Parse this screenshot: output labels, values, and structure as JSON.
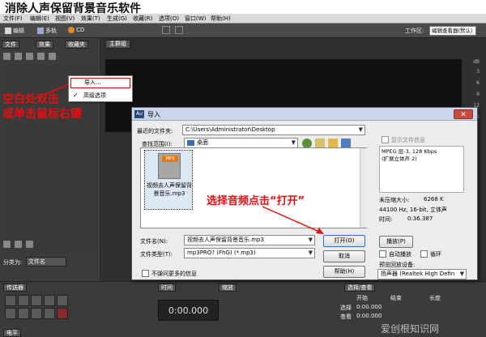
{
  "headline": "消除人声保留背景音乐软件",
  "menu": [
    "文件(F)",
    "编辑(E)",
    "视图(V)",
    "效果(T)",
    "生成(G)",
    "收藏(R)",
    "选项(O)",
    "窗口(W)",
    "帮助(H)"
  ],
  "toolbar": {
    "edit_label": "编辑",
    "multitrack_label": "多轨",
    "cd_label": "CD",
    "workspace_label": "工作区:",
    "workspace_value": "编辑查看器(默认)"
  },
  "left_panel": {
    "tabs": [
      "文件",
      "效果",
      "收藏夹"
    ],
    "sort_label": "分类为:",
    "sort_value": "文件名"
  },
  "main": {
    "tab": "主群组",
    "db_ticks": [
      "dB",
      "3",
      "6",
      "9",
      "12",
      "15"
    ]
  },
  "context_menu": {
    "items": [
      "导入...",
      "高级选项"
    ],
    "checked": "✓"
  },
  "annotations": {
    "left_line1": "空白处双击",
    "left_line2": "或单击鼠标右键",
    "middle": "选择音频点击“打开”"
  },
  "dialog": {
    "title": "导入",
    "recent_label": "最近的文件夹:",
    "recent_value": "C:\\Users\\Administrator\\Desktop",
    "lookin_label": "查找范围(I):",
    "lookin_value": "桌面",
    "file": {
      "badge": "MP3",
      "name": "视频去人声保留背景音乐.mp3"
    },
    "filename_label": "文件名(N):",
    "filename_value": "视频去人声保留背景音乐.mp3",
    "filetype_label": "文件类型(T):",
    "filetype_value": "mp3PRO? (FhG) (*.mp3)",
    "open_button": "打开(O)",
    "cancel_button": "取消",
    "help_button": "帮助(H)",
    "no_more_info": "不弹问更多的信息",
    "show_info_label": "显示文件信息",
    "info_text": "MPEG 层-3, 128 Kbps\n(扩展立体声 2)",
    "uncompressed_label": "未压缩大小:",
    "uncompressed_value": "6268 K",
    "format_line": "44100 Hz, 16-bit, 立体声",
    "time_label": "时间:",
    "time_value": "0:36.387",
    "play_button": "播放(P)",
    "autoplay_label": "自动播放",
    "loop_label": "循环",
    "preview_device_label": "预览回放设备:",
    "preview_device_value": "扬声器 (Realtek High Defin"
  },
  "transport": {
    "tab": "传送器",
    "time_tab": "时间",
    "zoom_tab": "缩放",
    "sel_tab": "选择/查看",
    "time_value": "0:00.000",
    "start_label": "开始",
    "end_label": "结束",
    "length_label": "长度",
    "select_label": "选择",
    "view_label": "查看",
    "select_start": "0:00.000",
    "view_start": "0:00.000",
    "level_tab": "电平"
  },
  "watermark": "爱创根知识网"
}
